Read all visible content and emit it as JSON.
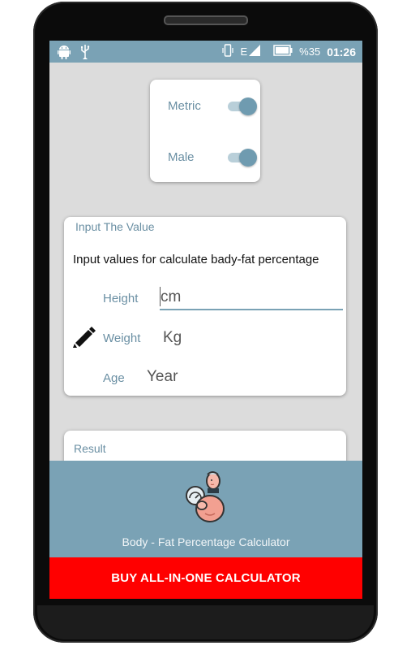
{
  "status_bar": {
    "battery_percent": "%35",
    "time": "01:26",
    "network": "E"
  },
  "toggles": {
    "metric_label": "Metric",
    "metric_on": true,
    "male_label": "Male",
    "male_on": true
  },
  "input_card": {
    "title": "Input The Value",
    "instruction": "Input values for calculate bady-fat percentage",
    "height_label": "Height",
    "height_placeholder": "cm",
    "weight_label": "Weight",
    "weight_placeholder": "Kg",
    "age_label": "Age",
    "age_placeholder": "Year"
  },
  "result": {
    "title": "Result"
  },
  "footer": {
    "app_name": "Body - Fat Percentage Calculator",
    "buy_label": "BUY ALL-IN-ONE CALCULATOR"
  },
  "icons": [
    "android-icon",
    "usb-icon",
    "vibrate-icon",
    "signal-icon",
    "battery-icon",
    "pencil-icon",
    "mascot-logo"
  ],
  "colors": {
    "accent": "#7aa2b5",
    "buy_button": "#ff0000"
  }
}
